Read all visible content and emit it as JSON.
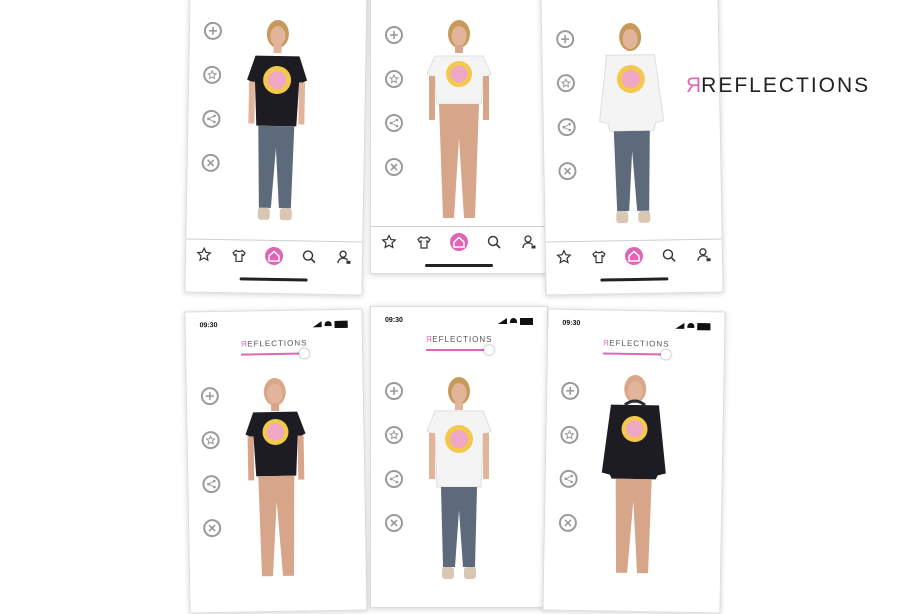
{
  "brand": {
    "mark": "R",
    "name": "REFLECTIONS"
  },
  "status": {
    "time": "09:30"
  },
  "mini_logo": {
    "mark": "R",
    "name": "EFLECTIONS"
  },
  "colors": {
    "accent": "#e066b5",
    "skin": "#d7a58a",
    "hair": "#c79a5c",
    "jeans": "#5c6a7c",
    "black_tee": "#1c1c22",
    "white_tee": "#f4f4f4",
    "print_yellow": "#f2c94c"
  },
  "side_icons": [
    "plus-icon",
    "star-icon",
    "share-icon",
    "close-icon"
  ],
  "tabbar_icons": [
    "star-icon",
    "wardrobe-icon",
    "home-icon",
    "search-icon",
    "profile-icon"
  ],
  "screens": [
    {
      "top": "black-tshirt, jeans",
      "variant": "photo"
    },
    {
      "top": "white-tshirt",
      "variant": "avatar"
    },
    {
      "top": "white-hoodie, jeans",
      "variant": "photo"
    },
    {
      "top": "black-tshirt",
      "variant": "avatar"
    },
    {
      "top": "white-tshirt, jeans",
      "variant": "photo"
    },
    {
      "top": "black-hoodie",
      "variant": "avatar"
    }
  ]
}
